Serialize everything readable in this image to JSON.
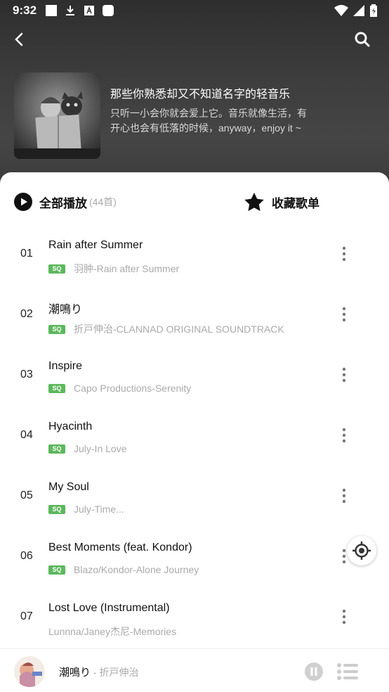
{
  "status_bar": {
    "time": "9:32"
  },
  "playlist": {
    "title": "那些你熟悉却又不知道名字的轻音乐",
    "description": "只听一小会你就会爱上它。音乐就像生活，有开心也会有低落的时候，anyway，enjoy it ~"
  },
  "actions": {
    "play_all_label": "全部播放",
    "play_all_count": "(44首)",
    "collect_label": "收藏歌单"
  },
  "badge_label": "SQ",
  "tracks": [
    {
      "num": "01",
      "title": "Rain after Summer",
      "artist": "羽肿-Rain after Summer",
      "sq": true
    },
    {
      "num": "02",
      "title": "潮鳴り",
      "artist": "折戸伸治-CLANNAD ORIGINAL SOUNDTRACK",
      "sq": true
    },
    {
      "num": "03",
      "title": "Inspire",
      "artist": "Capo Productions-Serenity",
      "sq": true
    },
    {
      "num": "04",
      "title": "Hyacinth",
      "artist": "July-In Love",
      "sq": true
    },
    {
      "num": "05",
      "title": "My Soul",
      "artist": "July-Time...",
      "sq": true
    },
    {
      "num": "06",
      "title": "Best Moments (feat. Kondor)",
      "artist": "Blazo/Kondor-Alone Journey",
      "sq": true
    },
    {
      "num": "07",
      "title": "Lost Love (Instrumental)",
      "artist": "Lunnna/Janey杰尼-Memories",
      "sq": false
    }
  ],
  "now_playing": {
    "title": "潮鳴り",
    "artist": " - 折戸伸治"
  },
  "icons": {
    "back": "back-icon",
    "search": "search-icon",
    "play": "play-circle-icon",
    "star": "star-icon",
    "more": "more-vertical-icon",
    "locate": "locate-icon",
    "pause": "pause-icon",
    "playlist": "playlist-icon"
  },
  "colors": {
    "sq_badge": "#5cb85c",
    "header_bg": "#3a3a3a"
  }
}
